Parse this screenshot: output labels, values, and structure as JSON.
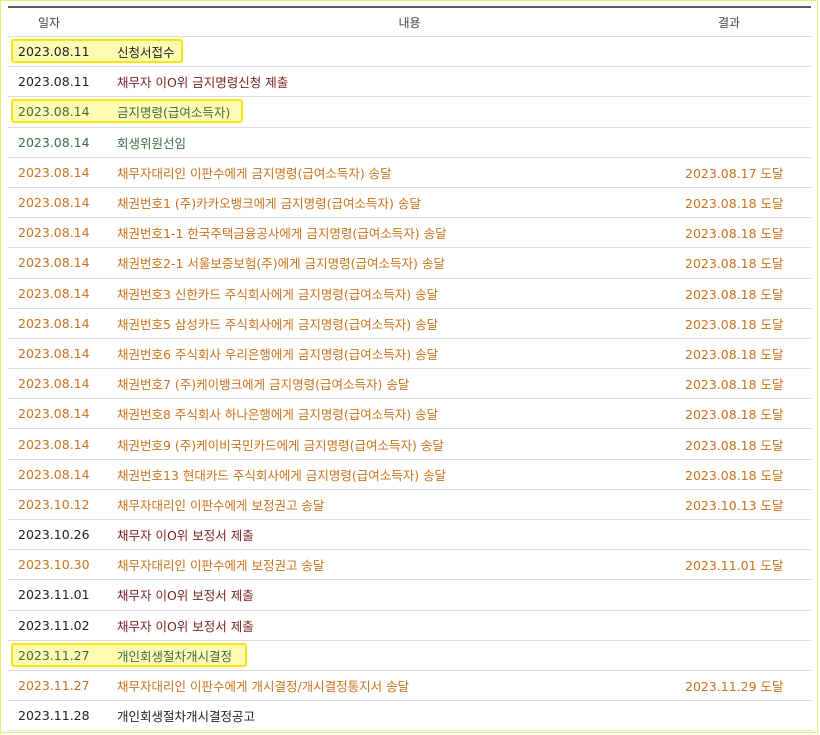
{
  "header": {
    "date": "일자",
    "content": "내용",
    "result": "결과"
  },
  "colors": {
    "orange": "#c9731c",
    "maroon": "#7a1f1f",
    "green": "#3e6b49",
    "black": "#222222",
    "highlight": "#ffe600"
  },
  "rows": [
    {
      "date": "2023.08.11",
      "content": "신청서접수",
      "result": "",
      "color": "#222222",
      "highlight": true
    },
    {
      "date": "2023.08.11",
      "content": "채무자 이O위 금지명령신청 제출",
      "result": "",
      "color": "#7a1f1f",
      "highlight": false
    },
    {
      "date": "2023.08.14",
      "content": "금지명령(급여소득자)",
      "result": "",
      "color": "#3e6b49",
      "highlight": true
    },
    {
      "date": "2023.08.14",
      "content": "회생위원선임",
      "result": "",
      "color": "#3e6b49",
      "highlight": false
    },
    {
      "date": "2023.08.14",
      "content": "채무자대리인 이판수에게 금지명령(급여소득자) 송달",
      "result": "2023.08.17 도달",
      "color": "#c9731c",
      "highlight": false
    },
    {
      "date": "2023.08.14",
      "content": "채권번호1 (주)카카오뱅크에게 금지명령(급여소득자) 송달",
      "result": "2023.08.18 도달",
      "color": "#c9731c",
      "highlight": false
    },
    {
      "date": "2023.08.14",
      "content": "채권번호1-1 한국주택금융공사에게 금지명령(급여소득자) 송달",
      "result": "2023.08.18 도달",
      "color": "#c9731c",
      "highlight": false
    },
    {
      "date": "2023.08.14",
      "content": "채권번호2-1 서울보증보험(주)에게 금지명령(급여소득자) 송달",
      "result": "2023.08.18 도달",
      "color": "#c9731c",
      "highlight": false
    },
    {
      "date": "2023.08.14",
      "content": "채권번호3 신한카드 주식회사에게 금지명령(급여소득자) 송달",
      "result": "2023.08.18 도달",
      "color": "#c9731c",
      "highlight": false
    },
    {
      "date": "2023.08.14",
      "content": "채권번호5 삼성카드 주식회사에게 금지명령(급여소득자) 송달",
      "result": "2023.08.18 도달",
      "color": "#c9731c",
      "highlight": false
    },
    {
      "date": "2023.08.14",
      "content": "채권번호6 주식회사 우리은행에게 금지명령(급여소득자) 송달",
      "result": "2023.08.18 도달",
      "color": "#c9731c",
      "highlight": false
    },
    {
      "date": "2023.08.14",
      "content": "채권번호7 (주)케이뱅크에게 금지명령(급여소득자) 송달",
      "result": "2023.08.18 도달",
      "color": "#c9731c",
      "highlight": false
    },
    {
      "date": "2023.08.14",
      "content": "채권번호8 주식회사 하나은행에게 금지명령(급여소득자) 송달",
      "result": "2023.08.18 도달",
      "color": "#c9731c",
      "highlight": false
    },
    {
      "date": "2023.08.14",
      "content": "채권번호9 (주)케이비국민카드에게 금지명령(급여소득자) 송달",
      "result": "2023.08.18 도달",
      "color": "#c9731c",
      "highlight": false
    },
    {
      "date": "2023.08.14",
      "content": "채권번호13 현대카드 주식회사에게 금지명령(급여소득자) 송달",
      "result": "2023.08.18 도달",
      "color": "#c9731c",
      "highlight": false
    },
    {
      "date": "2023.10.12",
      "content": "채무자대리인 이판수에게 보정권고 송달",
      "result": "2023.10.13 도달",
      "color": "#c9731c",
      "highlight": false
    },
    {
      "date": "2023.10.26",
      "content": "채무자 이O위 보정서 제출",
      "result": "",
      "color": "#7a1f1f",
      "highlight": false
    },
    {
      "date": "2023.10.30",
      "content": "채무자대리인 이판수에게 보정권고 송달",
      "result": "2023.11.01 도달",
      "color": "#c9731c",
      "highlight": false
    },
    {
      "date": "2023.11.01",
      "content": "채무자 이O위 보정서 제출",
      "result": "",
      "color": "#7a1f1f",
      "highlight": false
    },
    {
      "date": "2023.11.02",
      "content": "채무자 이O위 보정서 제출",
      "result": "",
      "color": "#7a1f1f",
      "highlight": false
    },
    {
      "date": "2023.11.27",
      "content": "개인회생절차개시결정",
      "result": "",
      "color": "#3e6b49",
      "highlight": true
    },
    {
      "date": "2023.11.27",
      "content": "채무자대리인 이판수에게 개시결정/개시결정통지서 송달",
      "result": "2023.11.29 도달",
      "color": "#c9731c",
      "highlight": false
    },
    {
      "date": "2023.11.28",
      "content": "개인회생절차개시결정공고",
      "result": "",
      "color": "#222222",
      "highlight": false
    }
  ]
}
